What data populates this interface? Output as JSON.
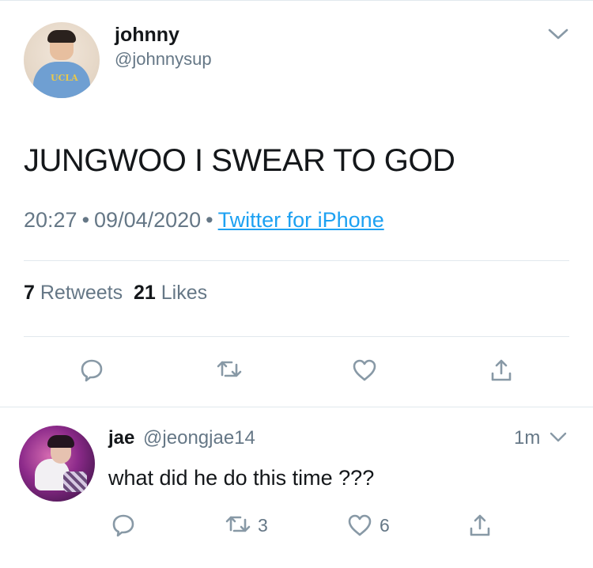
{
  "tweet": {
    "display_name": "johnny",
    "handle": "@johnnysup",
    "avatar_shirt_text": "UCLA",
    "text": "JUNGWOO I SWEAR TO GOD",
    "time": "20:27",
    "date": "09/04/2020",
    "separator": "•",
    "source": "Twitter for iPhone",
    "stats": {
      "retweets_count": "7",
      "retweets_label": "Retweets",
      "likes_count": "21",
      "likes_label": "Likes"
    }
  },
  "reply": {
    "display_name": "jae",
    "handle": "@jeongjae14",
    "time": "1m",
    "text": "what did he do this time ???",
    "retweet_count": "3",
    "like_count": "6"
  },
  "colors": {
    "text": "#14171a",
    "secondary": "#657786",
    "link": "#1da1f2",
    "divider": "#e1e8ed"
  },
  "icons": [
    "chevron-down-icon",
    "reply-icon",
    "retweet-icon",
    "like-icon",
    "share-icon"
  ]
}
